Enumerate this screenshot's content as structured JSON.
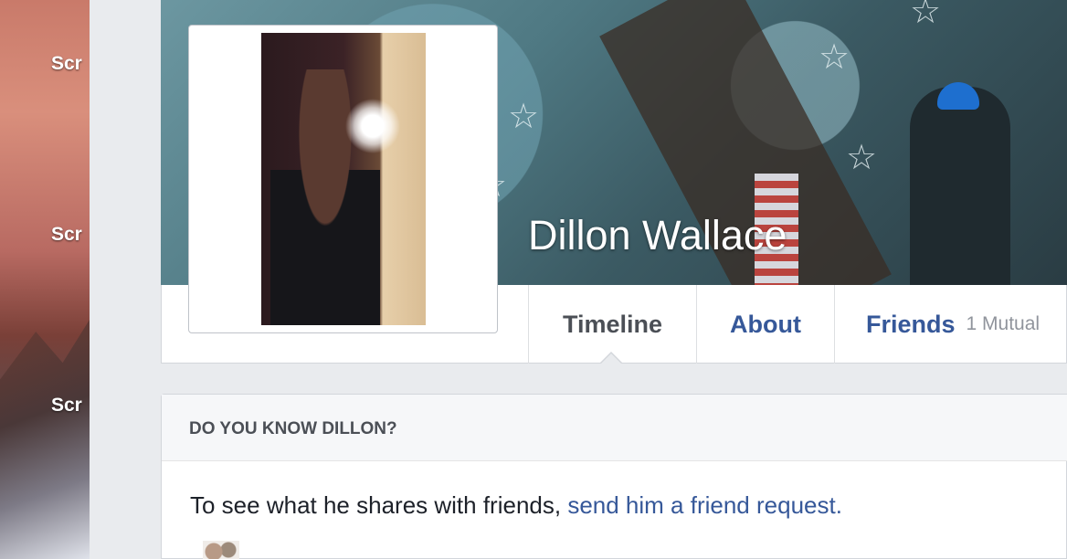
{
  "desktop": {
    "labels": [
      "Scr",
      "Scr",
      "Scr"
    ]
  },
  "profile": {
    "name": "Dillon Wallace"
  },
  "tabs": {
    "timeline": "Timeline",
    "about": "About",
    "friends": "Friends",
    "mutual": "1 Mutual"
  },
  "card": {
    "title": "DO YOU KNOW DILLON?",
    "text": "To see what he shares with friends, ",
    "link": "send him a friend request."
  }
}
